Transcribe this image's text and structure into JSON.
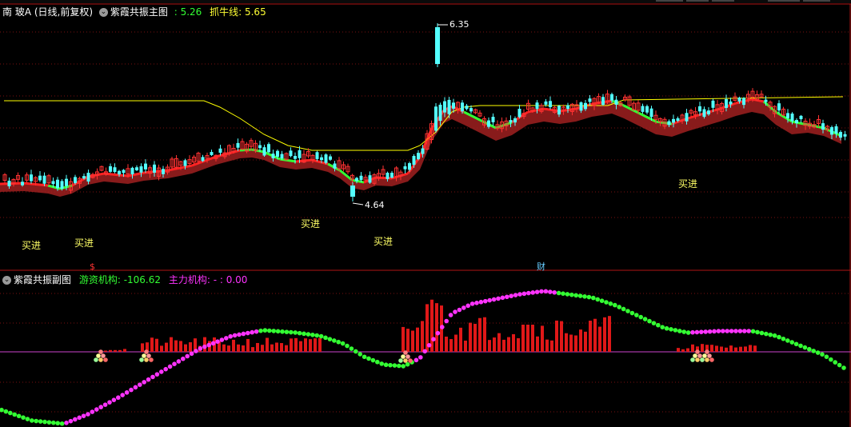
{
  "main_panel": {
    "stock_name": "南 玻A",
    "period_label": "(日线,前复权)",
    "indicator_name": "紫霞共振主图",
    "indicator_value": ": 5.26",
    "line_label": "抓牛线: 5.65",
    "high_label": "6.35",
    "low_label": "4.64",
    "signals": [
      "买进",
      "买进",
      "买进",
      "买进",
      "买进"
    ],
    "colors": {
      "up": "#ff3232",
      "down": "#54ffff",
      "ma": "#ffff00",
      "band_red": "#a02020",
      "band_green": "#33ff33"
    }
  },
  "event_markers": {
    "left": "$",
    "right": "财"
  },
  "sub_panel": {
    "indicator_name": "紫霞共振副图",
    "hot_money_label": "游资机构: -106.62",
    "main_force_label": "主力机构: - : 0.00",
    "colors": {
      "hot_money": "#33ff33",
      "main_force": "#ff33ff",
      "bars": "#e01818",
      "zero_line": "#cc44cc"
    }
  }
}
